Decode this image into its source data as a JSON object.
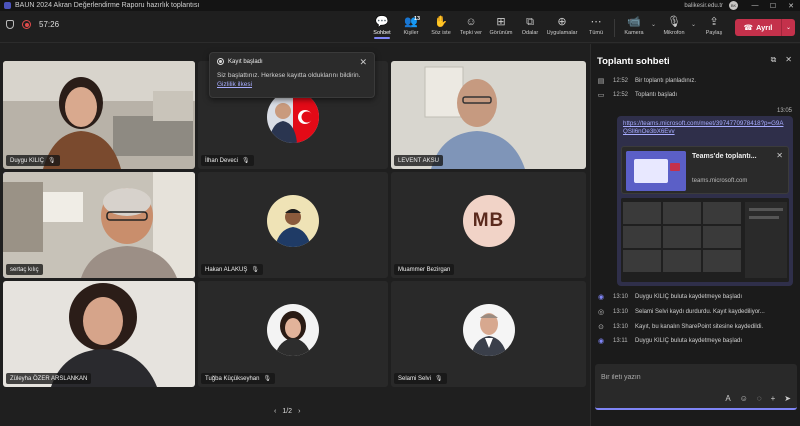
{
  "window": {
    "title": "BAUN 2024 Akran Değerlendirme Raporu hazırlık toplantısı",
    "domain": "balikesir.edu.tr",
    "user_initials": "BK",
    "min": "—",
    "max": "☐",
    "close": "✕"
  },
  "meeting": {
    "timer": "57:26"
  },
  "toolbar": {
    "chat_label": "Sohbet",
    "people_label": "Kişiler",
    "people_count": "13",
    "raise_label": "Söz iste",
    "react_label": "Tepki ver",
    "view_label": "Görünüm",
    "rooms_label": "Odalar",
    "apps_label": "Uygulamalar",
    "more_label": "Tümü",
    "camera_label": "Kamera",
    "mic_label": "Mikrofon",
    "share_label": "Paylaş",
    "leave_label": "Ayrıl"
  },
  "tiles": [
    {
      "name": "Duygu KILIÇ"
    },
    {
      "name": "İlhan Deveci"
    },
    {
      "name": "LEVENT AKSU"
    },
    {
      "name": "sertaç kılıç"
    },
    {
      "name": "Hakan ALAKUŞ"
    },
    {
      "name": "Muammer Bezirgan",
      "initials": "MB"
    },
    {
      "name": "Züleyha ÖZER ARSLANKAN"
    },
    {
      "name": "Tuğba Küçükseyhan"
    },
    {
      "name": "Selami Selvi"
    }
  ],
  "pager": {
    "text": "1/2",
    "prev": "‹",
    "next": "›"
  },
  "toast": {
    "title": "Kayıt başladı",
    "body": "Siz başlattınız. Herkese kayıtta olduklarını bildirin.",
    "link": "Gizlilik ilkesi"
  },
  "chat": {
    "title": "Toplantı sohbeti",
    "system_top": [
      {
        "time": "12:52",
        "text": "Bir toplantı planladınız."
      },
      {
        "time": "12:52",
        "text": "Toplantı başladı"
      }
    ],
    "message_time": "13:05",
    "message_link": "https://teams.microsoft.com/meet/3974770978418?p=G9AQSll6nOe3bX6Evv",
    "card_title": "Teams'de toplantı...",
    "card_domain": "teams.microsoft.com",
    "system_bottom": [
      {
        "time": "13:10",
        "text": "Duygu KILIÇ buluta kaydetmeye başladı"
      },
      {
        "time": "13:10",
        "text": "Selami Selvi kaydı durdurdu. Kayıt kaydediliyor..."
      },
      {
        "time": "13:10",
        "text": "Kayıt, bu kanalın SharePoint sitesine kaydedildi."
      },
      {
        "time": "13:11",
        "text": "Duygu KILIÇ buluta kaydetmeye başladı"
      }
    ],
    "compose_placeholder": "Bir ileti yazın"
  },
  "colors": {
    "accent": "#7f85f5",
    "leave": "#c4314b",
    "bg": "#1f1f1f"
  }
}
